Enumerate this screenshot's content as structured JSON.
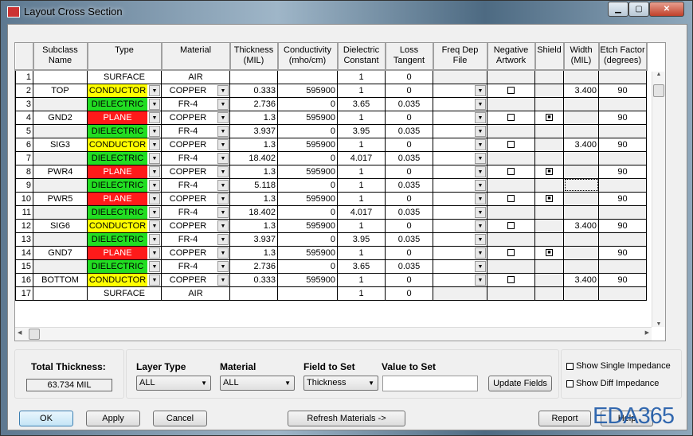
{
  "window": {
    "title": "Layout Cross Section"
  },
  "columns": [
    "",
    "Subclass\nName",
    "Type",
    "Material",
    "Thickness\n(MIL)",
    "Conductivity\n(mho/cm)",
    "Dielectric\nConstant",
    "Loss\nTangent",
    "Freq Dep\nFile",
    "Negative\nArtwork",
    "Shield",
    "Width\n(MIL)",
    "Etch Factor\n(degrees)"
  ],
  "type_colors": {
    "CONDUCTOR": "#ffff00",
    "DIELECTRIC": "#22dd22",
    "PLANE": "#ff1a1a",
    "SURFACE": "#ffffff"
  },
  "rows": [
    {
      "n": "1",
      "name": "",
      "type": "SURFACE",
      "mat": "AIR",
      "thk": "",
      "cond": "",
      "diel": "1",
      "loss": "0"
    },
    {
      "n": "2",
      "name": "TOP",
      "type": "CONDUCTOR",
      "mat": "COPPER",
      "thk": "0.333",
      "cond": "595900",
      "diel": "1",
      "loss": "0",
      "neg": false,
      "width": "3.400",
      "etch": "90"
    },
    {
      "n": "3",
      "name": "",
      "type": "DIELECTRIC",
      "mat": "FR-4",
      "thk": "2.736",
      "cond": "0",
      "diel": "3.65",
      "loss": "0.035"
    },
    {
      "n": "4",
      "name": "GND2",
      "type": "PLANE",
      "mat": "COPPER",
      "thk": "1.3",
      "cond": "595900",
      "diel": "1",
      "loss": "0",
      "neg": false,
      "shield": true,
      "etch": "90"
    },
    {
      "n": "5",
      "name": "",
      "type": "DIELECTRIC",
      "mat": "FR-4",
      "thk": "3.937",
      "cond": "0",
      "diel": "3.95",
      "loss": "0.035"
    },
    {
      "n": "6",
      "name": "SIG3",
      "type": "CONDUCTOR",
      "mat": "COPPER",
      "thk": "1.3",
      "cond": "595900",
      "diel": "1",
      "loss": "0",
      "neg": false,
      "width": "3.400",
      "etch": "90"
    },
    {
      "n": "7",
      "name": "",
      "type": "DIELECTRIC",
      "mat": "FR-4",
      "thk": "18.402",
      "cond": "0",
      "diel": "4.017",
      "loss": "0.035"
    },
    {
      "n": "8",
      "name": "PWR4",
      "type": "PLANE",
      "mat": "COPPER",
      "thk": "1.3",
      "cond": "595900",
      "diel": "1",
      "loss": "0",
      "neg": false,
      "shield": true,
      "etch": "90"
    },
    {
      "n": "9",
      "name": "",
      "type": "DIELECTRIC",
      "mat": "FR-4",
      "thk": "5.118",
      "cond": "0",
      "diel": "1",
      "loss": "0.035"
    },
    {
      "n": "10",
      "name": "PWR5",
      "type": "PLANE",
      "mat": "COPPER",
      "thk": "1.3",
      "cond": "595900",
      "diel": "1",
      "loss": "0",
      "neg": false,
      "shield": true,
      "etch": "90"
    },
    {
      "n": "11",
      "name": "",
      "type": "DIELECTRIC",
      "mat": "FR-4",
      "thk": "18.402",
      "cond": "0",
      "diel": "4.017",
      "loss": "0.035"
    },
    {
      "n": "12",
      "name": "SIG6",
      "type": "CONDUCTOR",
      "mat": "COPPER",
      "thk": "1.3",
      "cond": "595900",
      "diel": "1",
      "loss": "0",
      "neg": false,
      "width": "3.400",
      "etch": "90"
    },
    {
      "n": "13",
      "name": "",
      "type": "DIELECTRIC",
      "mat": "FR-4",
      "thk": "3.937",
      "cond": "0",
      "diel": "3.95",
      "loss": "0.035"
    },
    {
      "n": "14",
      "name": "GND7",
      "type": "PLANE",
      "mat": "COPPER",
      "thk": "1.3",
      "cond": "595900",
      "diel": "1",
      "loss": "0",
      "neg": false,
      "shield": true,
      "etch": "90"
    },
    {
      "n": "15",
      "name": "",
      "type": "DIELECTRIC",
      "mat": "FR-4",
      "thk": "2.736",
      "cond": "0",
      "diel": "3.65",
      "loss": "0.035"
    },
    {
      "n": "16",
      "name": "BOTTOM",
      "type": "CONDUCTOR",
      "mat": "COPPER",
      "thk": "0.333",
      "cond": "595900",
      "diel": "1",
      "loss": "0",
      "neg": false,
      "width": "3.400",
      "etch": "90"
    },
    {
      "n": "17",
      "name": "",
      "type": "SURFACE",
      "mat": "AIR",
      "thk": "",
      "cond": "",
      "diel": "1",
      "loss": "0"
    }
  ],
  "bottom": {
    "total_label": "Total Thickness:",
    "total_value": "63.734 MIL",
    "layer_type_label": "Layer Type",
    "layer_type_value": "ALL",
    "material_label": "Material",
    "material_value": "ALL",
    "field_label": "Field to Set",
    "field_value": "Thickness",
    "value_label": "Value to Set",
    "value_value": "",
    "update_button": "Update Fields",
    "show_single": "Show Single Impedance",
    "show_diff": "Show Diff Impedance"
  },
  "buttons": {
    "ok": "OK",
    "apply": "Apply",
    "cancel": "Cancel",
    "refresh": "Refresh Materials ->",
    "report": "Report",
    "help": "Help"
  },
  "watermark": "EDA365"
}
